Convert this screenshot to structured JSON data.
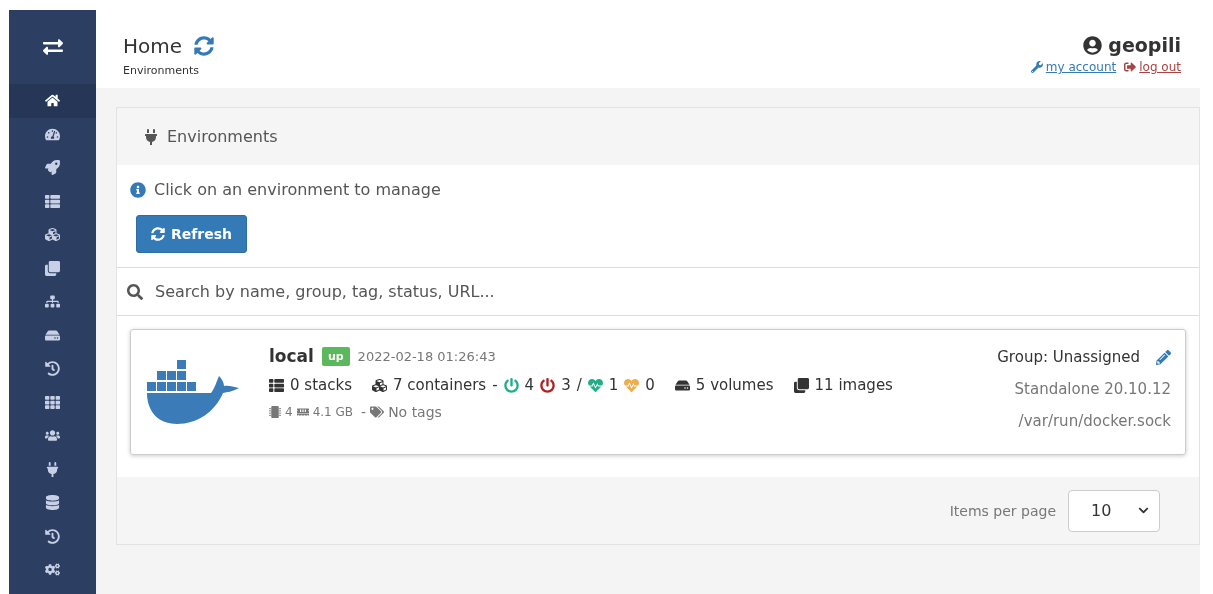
{
  "sidebar": {
    "items": [
      {
        "selected": true
      },
      {
        "selected": false
      },
      {
        "selected": false
      },
      {
        "selected": false
      },
      {
        "selected": false
      },
      {
        "selected": false
      },
      {
        "selected": false
      },
      {
        "selected": false
      },
      {
        "selected": false
      },
      {
        "selected": false
      },
      {
        "selected": false
      },
      {
        "selected": false
      },
      {
        "selected": false
      },
      {
        "selected": false
      },
      {
        "selected": false
      }
    ]
  },
  "header": {
    "title": "Home",
    "breadcrumb": "Environments",
    "user": "geopili",
    "links": [
      {
        "kind": "account",
        "label": "my account"
      },
      {
        "kind": "logout",
        "label": "log out"
      }
    ]
  },
  "panel": {
    "title": "Environments",
    "info": "Click on an environment to manage",
    "refresh_button": "Refresh",
    "search": {
      "placeholder": "Search by name, group, tag, status, URL..."
    },
    "environments": [
      {
        "name": "local",
        "status": "up",
        "timestamp": "2022-02-18 01:26:43",
        "stacks": "0 stacks",
        "containers": "7 containers",
        "containers_dash": "-",
        "running": "4",
        "stopped": "3",
        "separator": "/",
        "healthy": "1",
        "unhealthy": "0",
        "volumes": "5 volumes",
        "images": "11 images",
        "cpu": "4",
        "memory": "4.1 GB",
        "tags_dash": "-",
        "tags": "No tags",
        "group": "Group: Unassigned",
        "engine": "Standalone 20.10.12",
        "url": "/var/run/docker.sock"
      }
    ],
    "pagination": {
      "label": "Items per page",
      "value": "10"
    }
  }
}
